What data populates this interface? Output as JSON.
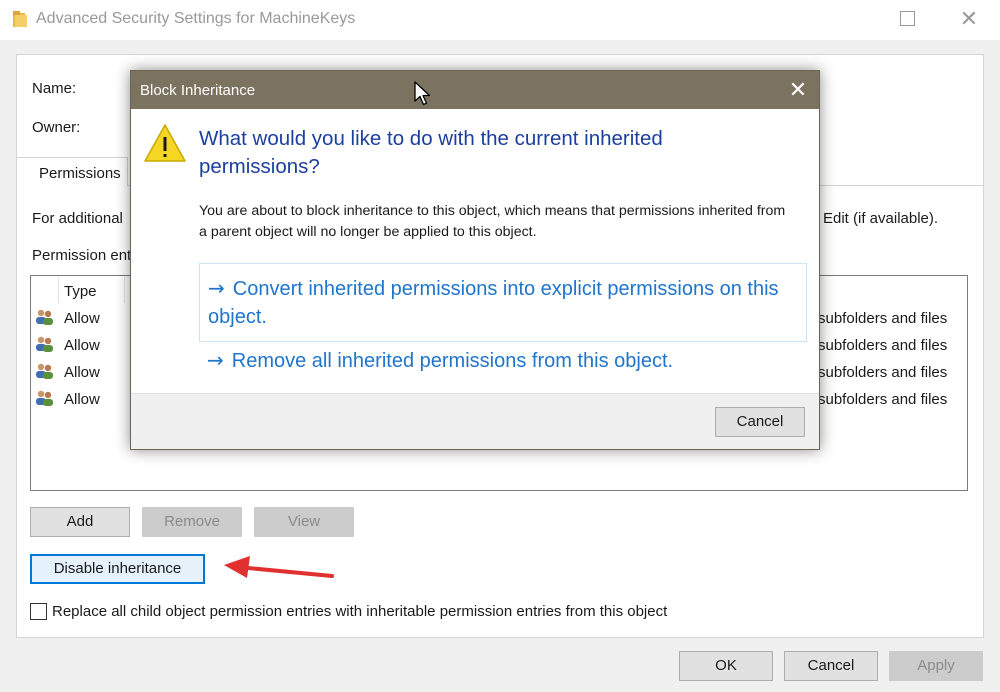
{
  "window": {
    "title": "Advanced Security Settings for MachineKeys",
    "close_glyph": "✕"
  },
  "main": {
    "name_label": "Name:",
    "owner_label": "Owner:",
    "tab_permissions": "Permissions",
    "info_text_left": "For additional",
    "info_text_right": "Edit (if available).",
    "entries_label": "Permission ent",
    "column_type": "Type",
    "rows": [
      {
        "type": "Allow",
        "applies_to": "subfolders and files"
      },
      {
        "type": "Allow",
        "applies_to": "subfolders and files"
      },
      {
        "type": "Allow",
        "applies_to": "subfolders and files"
      },
      {
        "type": "Allow",
        "applies_to": "subfolders and files"
      }
    ],
    "add_button": "Add",
    "remove_button": "Remove",
    "view_button": "View",
    "disable_inheritance_button": "Disable inheritance",
    "replace_checkbox_label": "Replace all child object permission entries with inheritable permission entries from this object",
    "replace_checkbox_checked": false
  },
  "footer": {
    "ok_button": "OK",
    "cancel_button": "Cancel",
    "apply_button": "Apply"
  },
  "dialog": {
    "title": "Block Inheritance",
    "close_glyph": "✕",
    "heading": "What would you like to do with the current inherited permissions?",
    "body": "You are about to block inheritance to this object, which means that permissions inherited from a parent object will no longer be applied to this object.",
    "option_convert": "Convert inherited permissions into explicit permissions on this object.",
    "option_remove": "Remove all inherited permissions from this object.",
    "arrow_glyph": "→",
    "cancel_button": "Cancel"
  },
  "colors": {
    "dialog_titlebar": "#7b725f",
    "heading_blue": "#1c3f9f",
    "link_blue": "#1f75cc",
    "annotation_arrow": "#e03030",
    "focus_border": "#0078d7"
  },
  "icons": {
    "folder": "folder-icon",
    "warning": "warning-icon",
    "users": "users-icon",
    "annotation_arrow": "red-arrow-annotation",
    "cursor": "mouse-cursor-icon"
  }
}
